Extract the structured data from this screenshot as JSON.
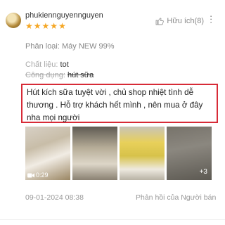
{
  "review": {
    "username": "phukiennguyennguyen",
    "rating": 5,
    "helpful_label": "Hữu ích(8)",
    "variant": "Phân loại: Máy NEW 99%",
    "fields": {
      "material_key": "Chất liệu:",
      "material_value": "tot",
      "usage_key": "Công dụng:",
      "usage_value": "hút sữa"
    },
    "text": "Hút kích sữa tuyệt vời , chủ shop nhiệt tình dễ thương . Hỗ trợ khách hết mình , nên mua ở đây nha mọi người",
    "media": {
      "video_duration": "0:29",
      "more_count": "+3"
    },
    "date": "09-01-2024 08:38",
    "reply_label": "Phản hồi của Người bán"
  },
  "colors": {
    "star": "#f5a623",
    "highlight_border": "#d72b37"
  }
}
